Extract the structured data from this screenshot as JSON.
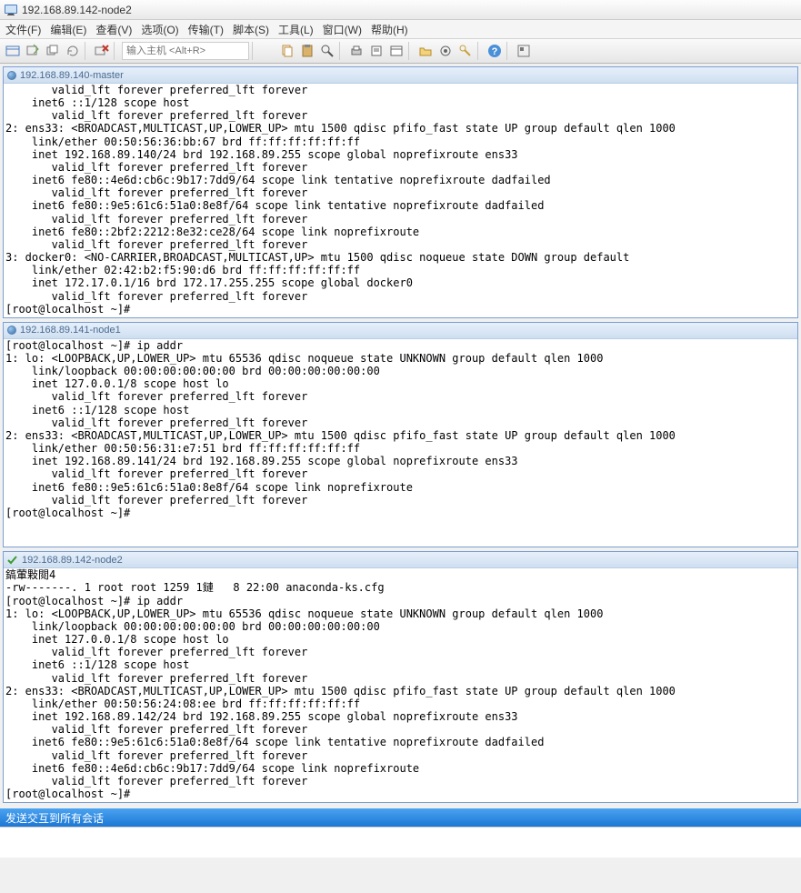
{
  "window": {
    "title": "192.168.89.142-node2"
  },
  "menu": {
    "file": "文件(F)",
    "edit": "编辑(E)",
    "view": "查看(V)",
    "options": "选项(O)",
    "transfer": "传输(T)",
    "script": "脚本(S)",
    "tools": "工具(L)",
    "window": "窗口(W)",
    "help": "帮助(H)",
    "host_placeholder": "输入主机 <Alt+R>"
  },
  "panels": [
    {
      "title": "192.168.89.140-master",
      "status": "blue",
      "content": "       valid_lft forever preferred_lft forever\n    inet6 ::1/128 scope host\n       valid_lft forever preferred_lft forever\n2: ens33: <BROADCAST,MULTICAST,UP,LOWER_UP> mtu 1500 qdisc pfifo_fast state UP group default qlen 1000\n    link/ether 00:50:56:36:bb:67 brd ff:ff:ff:ff:ff:ff\n    inet 192.168.89.140/24 brd 192.168.89.255 scope global noprefixroute ens33\n       valid_lft forever preferred_lft forever\n    inet6 fe80::4e6d:cb6c:9b17:7dd9/64 scope link tentative noprefixroute dadfailed\n       valid_lft forever preferred_lft forever\n    inet6 fe80::9e5:61c6:51a0:8e8f/64 scope link tentative noprefixroute dadfailed\n       valid_lft forever preferred_lft forever\n    inet6 fe80::2bf2:2212:8e32:ce28/64 scope link noprefixroute\n       valid_lft forever preferred_lft forever\n3: docker0: <NO-CARRIER,BROADCAST,MULTICAST,UP> mtu 1500 qdisc noqueue state DOWN group default\n    link/ether 02:42:b2:f5:90:d6 brd ff:ff:ff:ff:ff:ff\n    inet 172.17.0.1/16 brd 172.17.255.255 scope global docker0\n       valid_lft forever preferred_lft forever\n[root@localhost ~]#"
    },
    {
      "title": "192.168.89.141-node1",
      "status": "blue",
      "content": "[root@localhost ~]# ip addr\n1: lo: <LOOPBACK,UP,LOWER_UP> mtu 65536 qdisc noqueue state UNKNOWN group default qlen 1000\n    link/loopback 00:00:00:00:00:00 brd 00:00:00:00:00:00\n    inet 127.0.0.1/8 scope host lo\n       valid_lft forever preferred_lft forever\n    inet6 ::1/128 scope host\n       valid_lft forever preferred_lft forever\n2: ens33: <BROADCAST,MULTICAST,UP,LOWER_UP> mtu 1500 qdisc pfifo_fast state UP group default qlen 1000\n    link/ether 00:50:56:31:e7:51 brd ff:ff:ff:ff:ff:ff\n    inet 192.168.89.141/24 brd 192.168.89.255 scope global noprefixroute ens33\n       valid_lft forever preferred_lft forever\n    inet6 fe80::9e5:61c6:51a0:8e8f/64 scope link noprefixroute\n       valid_lft forever preferred_lft forever\n[root@localhost ~]#\n\n\n"
    },
    {
      "title": "192.168.89.142-node2",
      "status": "green",
      "content": "鎬葷敤閲4\n-rw-------. 1 root root 1259 1鏈   8 22:00 anaconda-ks.cfg\n[root@localhost ~]# ip addr\n1: lo: <LOOPBACK,UP,LOWER_UP> mtu 65536 qdisc noqueue state UNKNOWN group default qlen 1000\n    link/loopback 00:00:00:00:00:00 brd 00:00:00:00:00:00\n    inet 127.0.0.1/8 scope host lo\n       valid_lft forever preferred_lft forever\n    inet6 ::1/128 scope host\n       valid_lft forever preferred_lft forever\n2: ens33: <BROADCAST,MULTICAST,UP,LOWER_UP> mtu 1500 qdisc pfifo_fast state UP group default qlen 1000\n    link/ether 00:50:56:24:08:ee brd ff:ff:ff:ff:ff:ff\n    inet 192.168.89.142/24 brd 192.168.89.255 scope global noprefixroute ens33\n       valid_lft forever preferred_lft forever\n    inet6 fe80::9e5:61c6:51a0:8e8f/64 scope link tentative noprefixroute dadfailed\n       valid_lft forever preferred_lft forever\n    inet6 fe80::4e6d:cb6c:9b17:7dd9/64 scope link noprefixroute\n       valid_lft forever preferred_lft forever\n[root@localhost ~]#"
    }
  ],
  "status": {
    "text": "发送交互到所有会话"
  }
}
